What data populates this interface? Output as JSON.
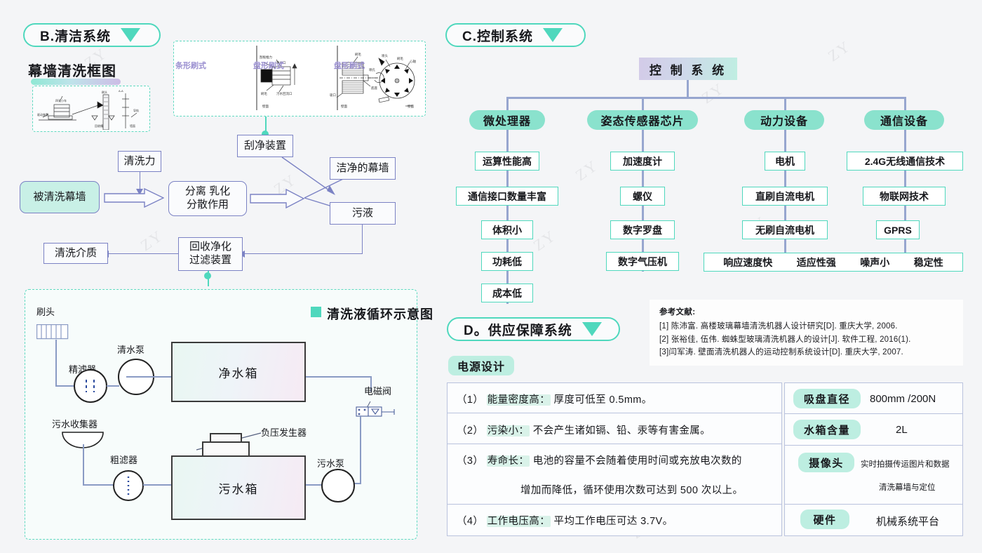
{
  "colors": {
    "teal": "#4fd8bd",
    "teal_soft": "#8ae2cd",
    "teal_pale": "#bdeee1",
    "purple_line": "#7b82c4",
    "tree_line": "#97a6cf",
    "bg": "#f4f5f7"
  },
  "watermark": "ZY",
  "sections": {
    "b": {
      "label": "B.清洁系统",
      "icon": "triangle-down-icon"
    },
    "c": {
      "label": "C.控制系统",
      "icon": "triangle-down-icon"
    },
    "d": {
      "label": "D。供应保障系统",
      "icon": "triangle-down-icon"
    }
  },
  "curtain_wall": {
    "title": "幕墙清洗框图",
    "brush_panel": {
      "labels": [
        "条形刷式",
        "盘形刷式",
        "盘形刷式"
      ]
    },
    "flow": {
      "cleaning_force": "清洗力",
      "scrape_device": "刮净装置",
      "washed_wall": "被清洗幕墙",
      "separation": "分离 乳化",
      "separation2": "分散作用",
      "clean_wall": "洁净的幕墙",
      "waste_liquid": "污液",
      "recovery1": "回收净化",
      "recovery2": "过滤装置",
      "medium": "清洗介质"
    }
  },
  "circulation": {
    "title": "清洗液循环示意图",
    "labels": {
      "brush_head": "刷头",
      "fine_filter": "精滤器",
      "clean_pump": "清水泵",
      "clean_tank": "净水箱",
      "solenoid_valve": "电磁阀",
      "sewage_collector": "污水收集器",
      "coarse_filter": "粗滤器",
      "negative_pressure": "负压发生器",
      "sewage_tank": "污水箱",
      "sewage_pump": "污水泵"
    }
  },
  "control_tree": {
    "root": "控 制 系 统",
    "branches": [
      {
        "head": "微处理器",
        "leaves": [
          "运算性能高",
          "通信接口数量丰富",
          "体积小",
          "功耗低",
          "成本低"
        ]
      },
      {
        "head": "姿态传感器芯片",
        "leaves": [
          "加速度计",
          "螺仪",
          "数字罗盘",
          "数字气压机"
        ]
      },
      {
        "head": "动力设备",
        "leaves": [
          "电机",
          "直刷自流电机",
          "无刷自流电机"
        ]
      },
      {
        "head": "通信设备",
        "leaves": [
          "2.4G无线通信技术",
          "物联网技术",
          "GPRS"
        ]
      }
    ],
    "footer_leaves": [
      "响应速度快",
      "适应性强",
      "噪声小",
      "稳定性"
    ]
  },
  "references": {
    "title": "参考文献:",
    "items": [
      "[1] 陈沛富. 高楼玻璃幕墙清洗机器人设计研究[D]. 重庆大学, 2006.",
      "[2] 张裕佳, 伍伟. 蜘蛛型玻璃清洗机器人的设计[J]. 软件工程, 2016(1).",
      "[3]闫军涛. 壁面清洗机器人的运动控制系统设计[D]. 重庆大学, 2007."
    ]
  },
  "power_design": {
    "tag": "电源设计",
    "rows": [
      {
        "num": "（1）",
        "key": "能量密度高：",
        "text": "厚度可低至 0.5mm。"
      },
      {
        "num": "（2）",
        "key": "污染小：",
        "text": "不会产生诸如镉、铅、汞等有害金属。"
      },
      {
        "num": "（3）",
        "key": "寿命长：",
        "text": "电池的容量不会随着使用时间或充放电次数的",
        "text2": "增加而降低，循环使用次数可达到 500 次以上。"
      },
      {
        "num": "（4）",
        "key": "工作电压高：",
        "text": "平均工作电压可达 3.7V。"
      }
    ],
    "specs": [
      {
        "key": "吸盘直径",
        "value": "800mm /200N",
        "value2": ""
      },
      {
        "key": "水箱含量",
        "value": "2L",
        "value2": ""
      },
      {
        "key": "摄像头",
        "value": "实时拍摄传运图片和数据",
        "value2": "清洗幕墙与定位"
      },
      {
        "key": "硬件",
        "value": "机械系统平台",
        "value2": ""
      }
    ]
  }
}
